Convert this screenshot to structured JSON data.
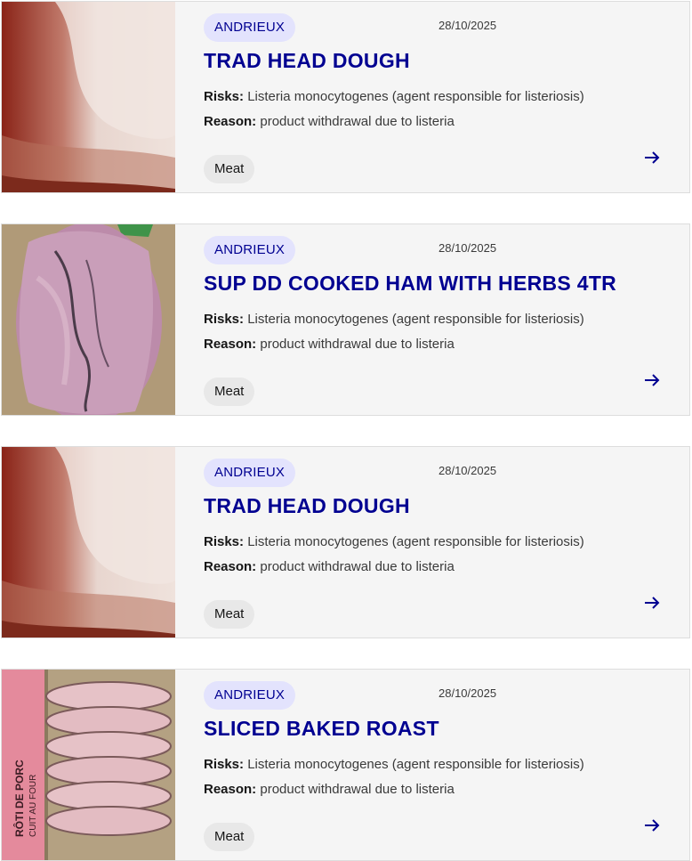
{
  "cards": [
    {
      "brand": "ANDRIEUX",
      "date": "28/10/2025",
      "title": "TRAD HEAD DOUGH",
      "risks_label": "Risks:",
      "risks_text": " Listeria monocytogenes (agent responsible for listeriosis)",
      "reason_label": "Reason:",
      "reason_text": " product withdrawal due to listeria",
      "category": "Meat"
    },
    {
      "brand": "ANDRIEUX",
      "date": "28/10/2025",
      "title": "SUP DD COOKED HAM WITH HERBS 4TR",
      "risks_label": "Risks:",
      "risks_text": " Listeria monocytogenes (agent responsible for listeriosis)",
      "reason_label": "Reason:",
      "reason_text": " product withdrawal due to listeria",
      "category": "Meat"
    },
    {
      "brand": "ANDRIEUX",
      "date": "28/10/2025",
      "title": "TRAD HEAD DOUGH",
      "risks_label": "Risks:",
      "risks_text": " Listeria monocytogenes (agent responsible for listeriosis)",
      "reason_label": "Reason:",
      "reason_text": " product withdrawal due to listeria",
      "category": "Meat"
    },
    {
      "brand": "ANDRIEUX",
      "date": "28/10/2025",
      "title": "SLICED BAKED ROAST",
      "risks_label": "Risks:",
      "risks_text": " Listeria monocytogenes (agent responsible for listeriosis)",
      "reason_label": "Reason:",
      "reason_text": " product withdrawal due to listeria",
      "category": "Meat",
      "package_label_1": "RÔTI DE PORC",
      "package_label_2": "CUIT AU FOUR"
    }
  ],
  "icons": {
    "arrow": "arrow-right-icon"
  },
  "colors": {
    "accent": "#000091",
    "badge_bg": "#e3e3fd",
    "card_bg": "#f5f5f5",
    "tag_bg": "#e8e8e8"
  }
}
